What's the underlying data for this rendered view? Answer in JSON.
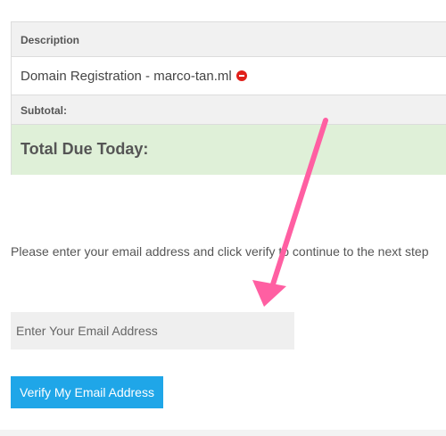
{
  "order": {
    "description_header": "Description",
    "item_label": "Domain Registration - marco-tan.ml",
    "subtotal_label": "Subtotal:",
    "total_label": "Total Due Today:"
  },
  "instruction_text": "Please enter your email address and click verify to continue to the next step",
  "email": {
    "placeholder": "Enter Your Email Address",
    "value": ""
  },
  "verify_button_label": "Verify My Email Address",
  "colors": {
    "total_row_bg": "#dff0d8",
    "button_bg": "#1fa6e8",
    "remove_icon": "#e0201a",
    "annotation_arrow": "#ff5fa2"
  },
  "icons": {
    "remove": "remove-icon",
    "annotation": "annotation-arrow"
  }
}
